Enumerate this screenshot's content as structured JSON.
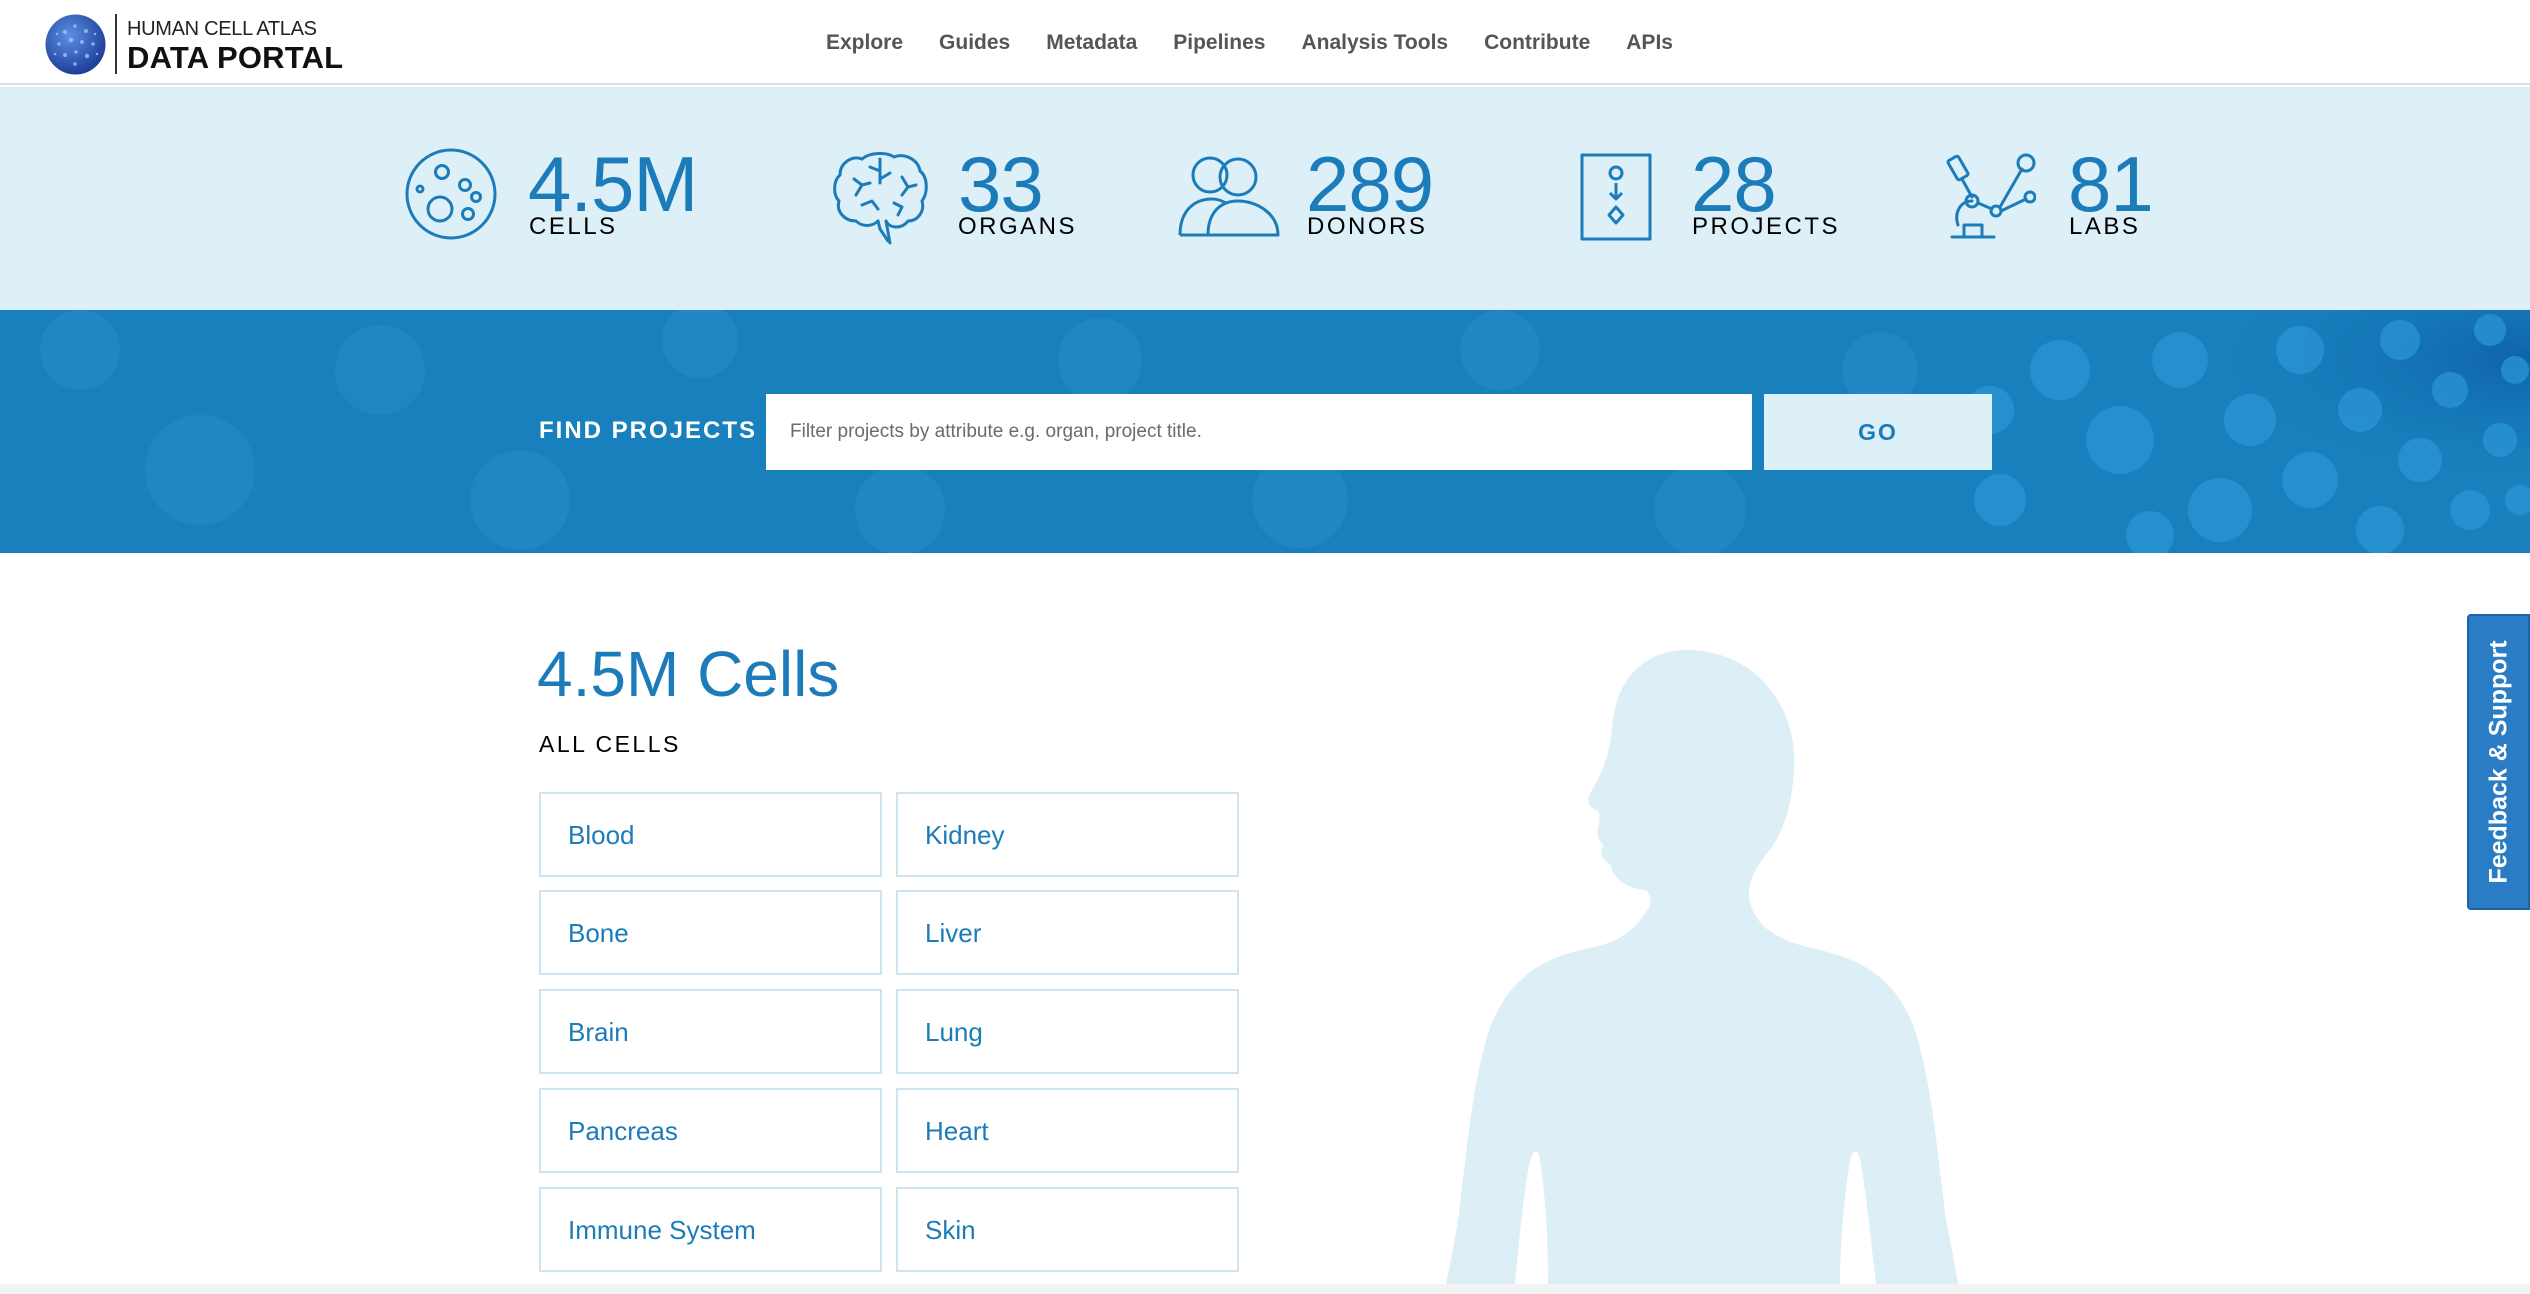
{
  "header": {
    "logo_line1": "HUMAN CELL ATLAS",
    "logo_line2": "DATA PORTAL",
    "nav": [
      "Explore",
      "Guides",
      "Metadata",
      "Pipelines",
      "Analysis Tools",
      "Contribute",
      "APIs"
    ]
  },
  "stats": {
    "cells": {
      "value": "4.5M",
      "label": "CELLS",
      "icon": "cells-icon"
    },
    "organs": {
      "value": "33",
      "label": "ORGANS",
      "icon": "brain-icon"
    },
    "donors": {
      "value": "289",
      "label": "DONORS",
      "icon": "donors-icon"
    },
    "projects": {
      "value": "28",
      "label": "PROJECTS",
      "icon": "projects-icon"
    },
    "labs": {
      "value": "81",
      "label": "LABS",
      "icon": "microscope-icon"
    }
  },
  "search": {
    "label": "FIND PROJECTS",
    "placeholder": "Filter projects by attribute e.g. organ, project title.",
    "value": "",
    "button": "GO"
  },
  "main": {
    "heading": "4.5M Cells",
    "subheading": "ALL CELLS",
    "organs": [
      "Blood",
      "Kidney",
      "Bone",
      "Liver",
      "Brain",
      "Lung",
      "Pancreas",
      "Heart",
      "Immune System",
      "Skin"
    ]
  },
  "feedback": {
    "label": "Feedback & Support"
  },
  "colors": {
    "accent": "#1c7cba",
    "stats_bg": "#ddeff7",
    "search_bg": "#1880bd",
    "feedback_bg": "#2a7dc4"
  }
}
